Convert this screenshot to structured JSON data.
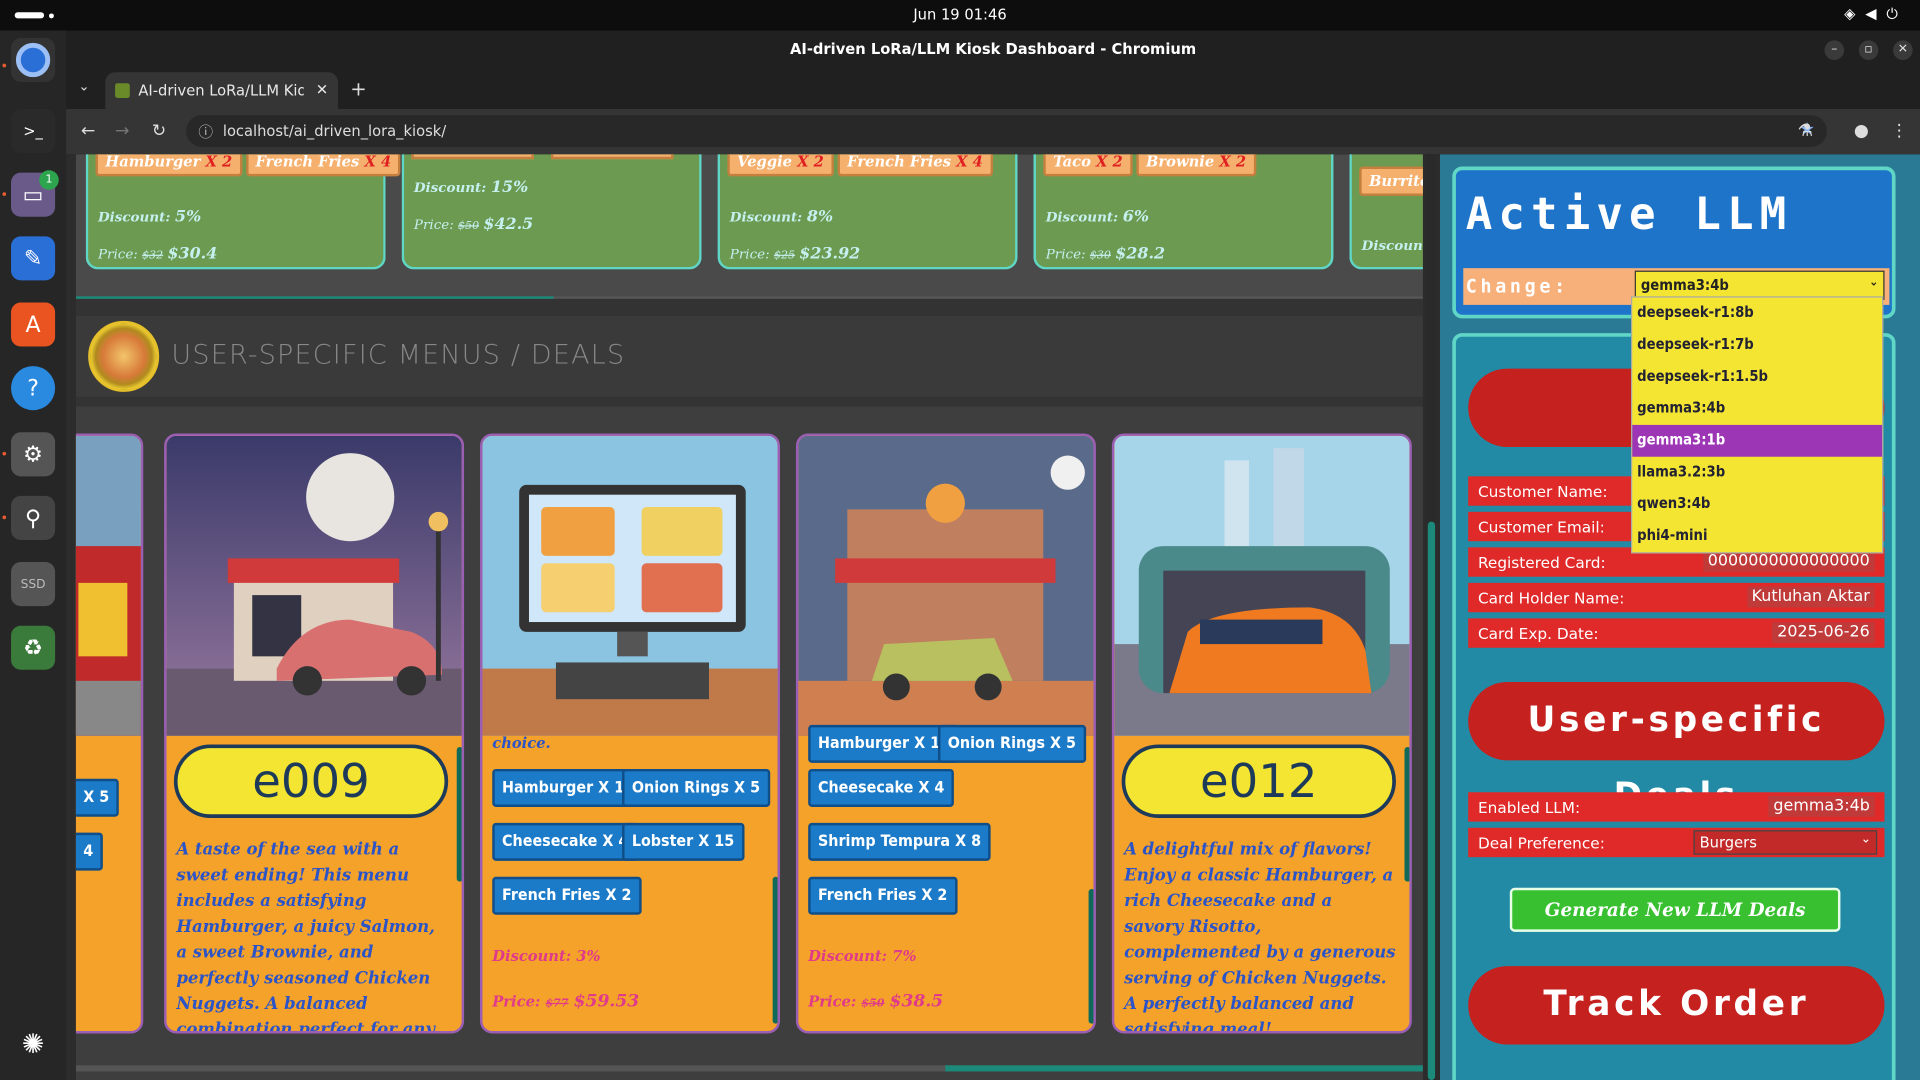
{
  "os": {
    "clock": "Jun 19  01:46"
  },
  "window": {
    "title": "AI-driven LoRa/LLM Kiosk Dashboard - Chromium"
  },
  "tab": {
    "label": "AI-driven LoRa/LLM Kiosk"
  },
  "address": {
    "url": "localhost/ai_driven_lora_kiosk/"
  },
  "dock": {
    "files_badge": "1",
    "ssd_label": "SSD"
  },
  "offers": [
    {
      "tags": [
        {
          "n": "Hamburger",
          "q": "X 2"
        },
        {
          "n": "French Fries",
          "q": "X 4"
        }
      ],
      "discount_label": "Discount:",
      "discount": "5%",
      "price_label": "Price:",
      "old_price": "$32",
      "price": "$30.4"
    },
    {
      "tags": [],
      "discount_label": "Discount:",
      "discount": "15%",
      "price_label": "Price:",
      "old_price": "$50",
      "price": "$42.5"
    },
    {
      "tags": [
        {
          "n": "Veggie",
          "q": "X 2"
        },
        {
          "n": "French Fries",
          "q": "X 4"
        }
      ],
      "discount_label": "Discount:",
      "discount": "8%",
      "price_label": "Price:",
      "old_price": "$25",
      "price": "$23.92"
    },
    {
      "tags": [
        {
          "n": "Taco",
          "q": "X 2"
        },
        {
          "n": "Brownie",
          "q": "X 2"
        }
      ],
      "discount_label": "Discount:",
      "discount": "6%",
      "price_label": "Price:",
      "old_price": "$30",
      "price": "$28.2"
    },
    {
      "tags": [
        {
          "n": "Burrito",
          "q": "X"
        }
      ],
      "discount_label": "Discount:",
      "discount": "",
      "price_label": "",
      "old_price": "",
      "price": ""
    }
  ],
  "section": {
    "title": "USER-SPECIFIC MENUS / DEALS"
  },
  "cards": {
    "partial": {
      "q1": "X 5",
      "q2": "4"
    },
    "e009": {
      "id": "e009",
      "desc": "A taste of the sea with a sweet ending! This menu includes a satisfying Hamburger, a juicy Salmon, a sweet Brownie, and perfectly seasoned Chicken Nuggets. A balanced combination perfect for any occasion!"
    },
    "c2": {
      "top": "choice.",
      "tags": [
        {
          "n": "Hamburger",
          "q": "X 12"
        },
        {
          "n": "Onion Rings",
          "q": "X 5"
        },
        {
          "n": "Cheesecake",
          "q": "X 4"
        },
        {
          "n": "Lobster",
          "q": "X 15"
        },
        {
          "n": "French Fries",
          "q": "X 2"
        }
      ],
      "discount_label": "Discount:",
      "discount": "3%",
      "price_label": "Price:",
      "old_price": "$77",
      "price": "$59.53"
    },
    "c3": {
      "tags": [
        {
          "n": "Hamburger",
          "q": "X 12"
        },
        {
          "n": "Onion Rings",
          "q": "X 5"
        },
        {
          "n": "Cheesecake",
          "q": "X 4"
        },
        {
          "n": "Shrimp Tempura",
          "q": "X 8"
        },
        {
          "n": "French Fries",
          "q": "X 2"
        }
      ],
      "discount_label": "Discount:",
      "discount": "7%",
      "price_label": "Price:",
      "old_price": "$50",
      "price": "$38.5"
    },
    "e012": {
      "id": "e012",
      "desc": "A delightful mix of flavors! Enjoy a classic Hamburger, a rich Cheesecake and a savory Risotto, complemented by a generous serving of Chicken Nuggets. A perfectly balanced and satisfying meal!"
    }
  },
  "llm": {
    "title": "Active LLM",
    "change_label": "Change:",
    "selected": "gemma3:4b",
    "options": [
      "deepseek-r1:8b",
      "deepseek-r1:7b",
      "deepseek-r1:1.5b",
      "gemma3:4b",
      "gemma3:1b",
      "llama3.2:3b",
      "qwen3:4b",
      "phi4-mini"
    ],
    "highlighted": "gemma3:1b"
  },
  "customer": {
    "top_button": "I",
    "name_label": "Customer Name:",
    "email_label": "Customer Email:",
    "card_label": "Registered Card:",
    "card_value": "0000000000000000",
    "holder_label": "Card Holder Name:",
    "holder_value": "Kutluhan Aktar",
    "exp_label": "Card Exp. Date:",
    "exp_value": "2025-06-26"
  },
  "deals": {
    "button": "User-specific Deals",
    "enabled_label": "Enabled LLM:",
    "enabled_value": "gemma3:4b",
    "pref_label": "Deal Preference:",
    "pref_value": "Burgers",
    "generate": "Generate New LLM Deals",
    "track": "Track Order"
  }
}
